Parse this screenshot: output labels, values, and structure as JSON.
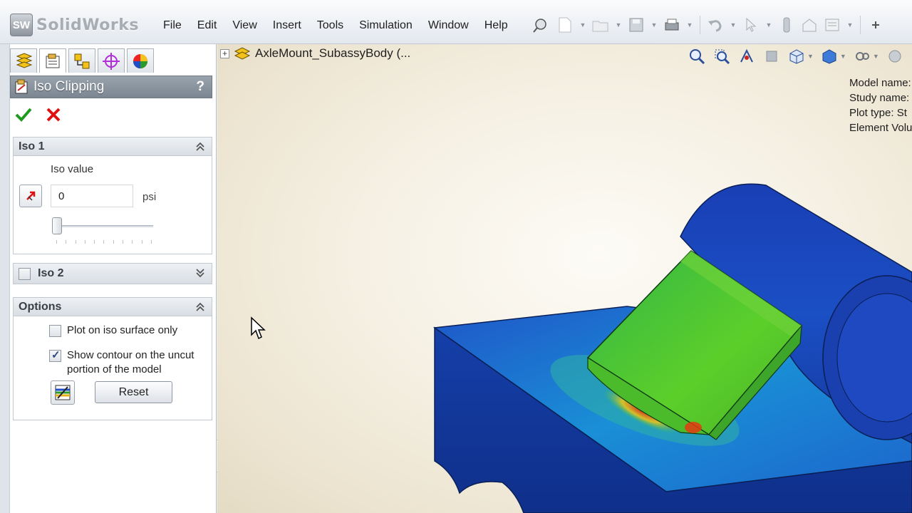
{
  "app": {
    "logo_text": "SolidWorks",
    "logo_badge": "SW",
    "menu": [
      "File",
      "Edit",
      "View",
      "Insert",
      "Tools",
      "Simulation",
      "Window",
      "Help"
    ]
  },
  "panel": {
    "tabs": [
      "feature-manager-tab",
      "property-manager-tab",
      "configuration-manager-tab",
      "dimxpert-tab",
      "display-manager-tab"
    ],
    "title": "Iso Clipping",
    "help": "?",
    "iso1": {
      "title": "Iso 1",
      "iso_value_label": "Iso value",
      "iso_value": "0",
      "unit": "psi",
      "slider_fraction": 0.0
    },
    "iso2": {
      "title": "Iso 2",
      "checked": false
    },
    "options": {
      "title": "Options",
      "plot_on_iso_label": "Plot on iso surface only",
      "plot_on_iso_checked": false,
      "show_contour_label": "Show contour on the uncut portion of the model",
      "show_contour_checked": true,
      "reset_label": "Reset"
    }
  },
  "viewport": {
    "tree_item": "AxleMount_SubassyBody  (...",
    "model_info": [
      "Model name:",
      "Study name:",
      "Plot type: St",
      "Element Volu"
    ]
  },
  "colors": {
    "accent_header": "#7c8692",
    "stress_low": "#1a3fb0",
    "stress_mid": "#3fbf2a",
    "stress_high": "#d23a1a"
  }
}
